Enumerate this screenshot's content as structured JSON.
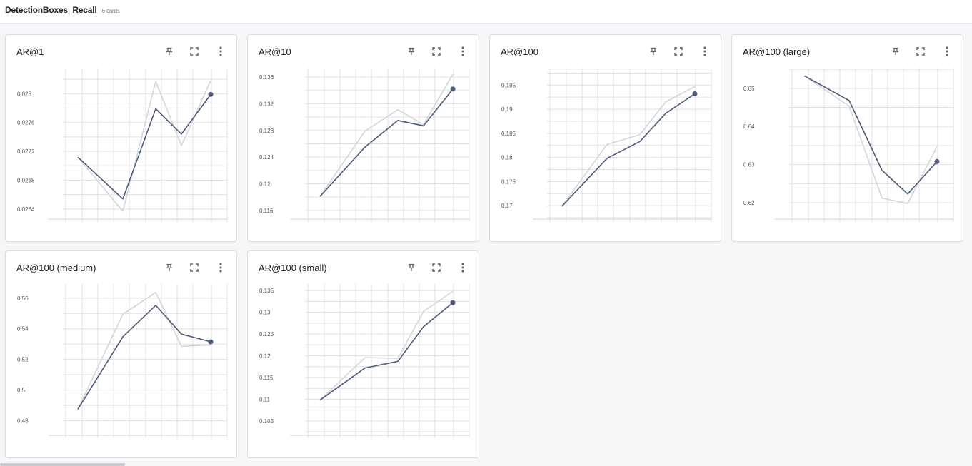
{
  "section": {
    "title": "DetectionBoxes_Recall",
    "count": "6 cards"
  },
  "colors": {
    "smoothed": "#4a5a78",
    "raw": "#d3d5d9",
    "grid": "#e0e0e0"
  },
  "icons": {
    "pin": "pin-icon",
    "expand": "fullscreen-icon",
    "more": "more-vert-icon"
  },
  "cards": [
    {
      "title": "AR@1",
      "chart_data": {
        "type": "line",
        "yticks": [
          "0.028",
          "0.0276",
          "0.0272",
          "0.0268",
          "0.0264"
        ],
        "ylim": [
          0.02626,
          0.02836
        ],
        "x": [
          1,
          2,
          3,
          4,
          5
        ],
        "series": [
          {
            "values": [
              0.02712,
              0.02637,
              0.02817,
              0.02728,
              0.02818
            ]
          },
          {
            "values": [
              0.02712,
              0.02654,
              0.02779,
              0.02744,
              0.02799
            ]
          }
        ]
      }
    },
    {
      "title": "AR@10",
      "chart_data": {
        "type": "line",
        "yticks": [
          "0.136",
          "0.132",
          "0.128",
          "0.124",
          "0.12",
          "0.116"
        ],
        "ylim": [
          0.1147,
          0.1374
        ],
        "x": [
          1,
          2,
          3,
          4,
          5
        ],
        "series": [
          {
            "values": [
              0.1181,
              0.1279,
              0.1311,
              0.1289,
              0.1364
            ]
          },
          {
            "values": [
              0.1181,
              0.1255,
              0.1295,
              0.1287,
              0.1342
            ]
          }
        ]
      }
    },
    {
      "title": "AR@100",
      "chart_data": {
        "type": "line",
        "yticks": [
          "0.195",
          "0.19",
          "0.185",
          "0.18",
          "0.175",
          "0.17"
        ],
        "ylim": [
          0.1672,
          0.1986
        ],
        "x": [
          1,
          2,
          3,
          4,
          5
        ],
        "series": [
          {
            "values": [
              0.1699,
              0.1827,
              0.1847,
              0.1915,
              0.1947
            ]
          },
          {
            "values": [
              0.1699,
              0.1798,
              0.1833,
              0.1891,
              0.1932
            ]
          }
        ]
      }
    },
    {
      "title": "AR@100 (large)",
      "chart_data": {
        "type": "line",
        "yticks": [
          "0.65",
          "0.64",
          "0.63",
          "0.62"
        ],
        "ylim": [
          0.6157,
          0.6554
        ],
        "x": [
          1,
          2,
          3,
          4,
          5
        ],
        "series": [
          {
            "values": [
              0.6533,
              0.6453,
              0.6212,
              0.6198,
              0.6347
            ]
          },
          {
            "values": [
              0.6533,
              0.6468,
              0.6285,
              0.6223,
              0.6308
            ]
          }
        ]
      }
    },
    {
      "title": "AR@100 (medium)",
      "chart_data": {
        "type": "line",
        "yticks": [
          "0.56",
          "0.54",
          "0.52",
          "0.5",
          "0.48"
        ],
        "ylim": [
          0.4705,
          0.5692
        ],
        "x": [
          1,
          2,
          3,
          4,
          5
        ],
        "series": [
          {
            "values": [
              0.4875,
              0.5495,
              0.5637,
              0.5285,
              0.5295
            ]
          },
          {
            "values": [
              0.4875,
              0.5348,
              0.5553,
              0.5365,
              0.5315
            ]
          }
        ]
      }
    },
    {
      "title": "AR@100 (small)",
      "chart_data": {
        "type": "line",
        "yticks": [
          "0.135",
          "0.13",
          "0.125",
          "0.12",
          "0.115",
          "0.11",
          "0.105"
        ],
        "ylim": [
          0.1017,
          0.1365
        ],
        "x": [
          1,
          2,
          3,
          4,
          5
        ],
        "series": [
          {
            "values": [
              0.1098,
              0.1196,
              0.1194,
              0.1302,
              0.1348
            ]
          },
          {
            "values": [
              0.1098,
              0.1172,
              0.1187,
              0.1267,
              0.1322
            ]
          }
        ]
      }
    }
  ]
}
